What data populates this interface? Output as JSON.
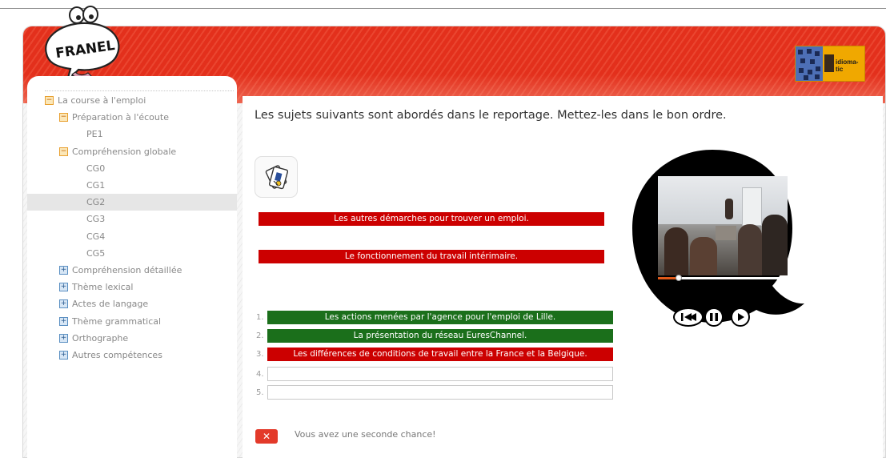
{
  "logo": {
    "text": "FRANEL"
  },
  "partner_logo": {
    "text": "idioma-tic"
  },
  "sidebar": {
    "items": [
      {
        "label": "La course à l'emploi",
        "level": 0,
        "toggle": "minus"
      },
      {
        "label": "Préparation à l'écoute",
        "level": 1,
        "toggle": "minus"
      },
      {
        "label": "PE1",
        "level": 2
      },
      {
        "label": "Compréhension globale",
        "level": 1,
        "toggle": "minus"
      },
      {
        "label": "CG0",
        "level": 2
      },
      {
        "label": "CG1",
        "level": 2
      },
      {
        "label": "CG2",
        "level": 2,
        "active": true
      },
      {
        "label": "CG3",
        "level": 2
      },
      {
        "label": "CG4",
        "level": 2
      },
      {
        "label": "CG5",
        "level": 2
      },
      {
        "label": "Compréhension détaillée",
        "level": 1,
        "toggle": "plus"
      },
      {
        "label": "Thème lexical",
        "level": 1,
        "toggle": "plus"
      },
      {
        "label": "Actes de langage",
        "level": 1,
        "toggle": "plus"
      },
      {
        "label": "Thème grammatical",
        "level": 1,
        "toggle": "plus"
      },
      {
        "label": "Orthographe",
        "level": 1,
        "toggle": "plus"
      },
      {
        "label": "Autres compétences",
        "level": 1,
        "toggle": "plus"
      }
    ]
  },
  "exercise": {
    "instruction": "Les sujets suivants sont abordés dans le reportage. Mettez-les dans le bon ordre.",
    "pool": [
      "Les autres démarches pour trouver un emploi.",
      "Le fonctionnement du travail intérimaire."
    ],
    "slots": [
      {
        "number": "1.",
        "text": "Les actions menées par l'agence pour l'emploi de Lille.",
        "state": "correct"
      },
      {
        "number": "2.",
        "text": "La présentation du réseau EuresChannel.",
        "state": "correct"
      },
      {
        "number": "3.",
        "text": "Les différences de conditions de travail entre la France et la Belgique.",
        "state": "wrong"
      },
      {
        "number": "4.",
        "text": "",
        "state": "empty"
      },
      {
        "number": "5.",
        "text": "",
        "state": "empty"
      }
    ]
  },
  "video": {
    "progress": 0.16
  },
  "feedback": {
    "icon": "✕",
    "message": "Vous avez une seconde chance!"
  },
  "colors": {
    "banner_red": "#e3301c",
    "wrong_red": "#cc0000",
    "correct_green": "#1b6f1b"
  }
}
